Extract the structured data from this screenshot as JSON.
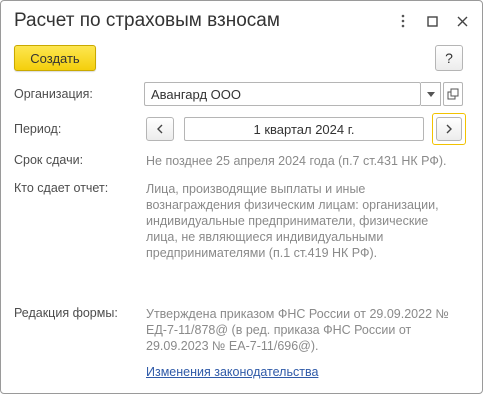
{
  "window": {
    "title": "Расчет по страховым взносам"
  },
  "toolbar": {
    "create_label": "Создать",
    "help_label": "?"
  },
  "form": {
    "organization": {
      "label": "Организация:",
      "value": "Авангард ООО"
    },
    "period": {
      "label": "Период:",
      "value": "1 квартал 2024 г."
    },
    "deadline": {
      "label": "Срок сдачи:",
      "value": "Не позднее 25 апреля 2024 года (п.7 ст.431 НК РФ)."
    },
    "who_submits": {
      "label": "Кто сдает отчет:",
      "lines": [
        "Лица, производящие выплаты и иные",
        "вознаграждения физическим лицам: организации,",
        "индивидуальные предприниматели, физические",
        "лица, не являющиеся индивидуальными",
        "предпринимателями (п.1 ст.419 НК РФ)."
      ]
    },
    "form_edition": {
      "label": "Редакция формы:",
      "lines": [
        "Утверждена приказом ФНС России от 29.09.2022 №",
        "ЕД-7-11/878@ (в ред. приказа ФНС России от",
        "29.09.2023 № ЕА-7-11/696@)."
      ]
    }
  },
  "links": {
    "legislation_changes": "Изменения законодательства"
  },
  "colors": {
    "accent_yellow": "#f4cf0c",
    "link_blue": "#2f5aa8",
    "muted_text": "#8a8a8a"
  }
}
